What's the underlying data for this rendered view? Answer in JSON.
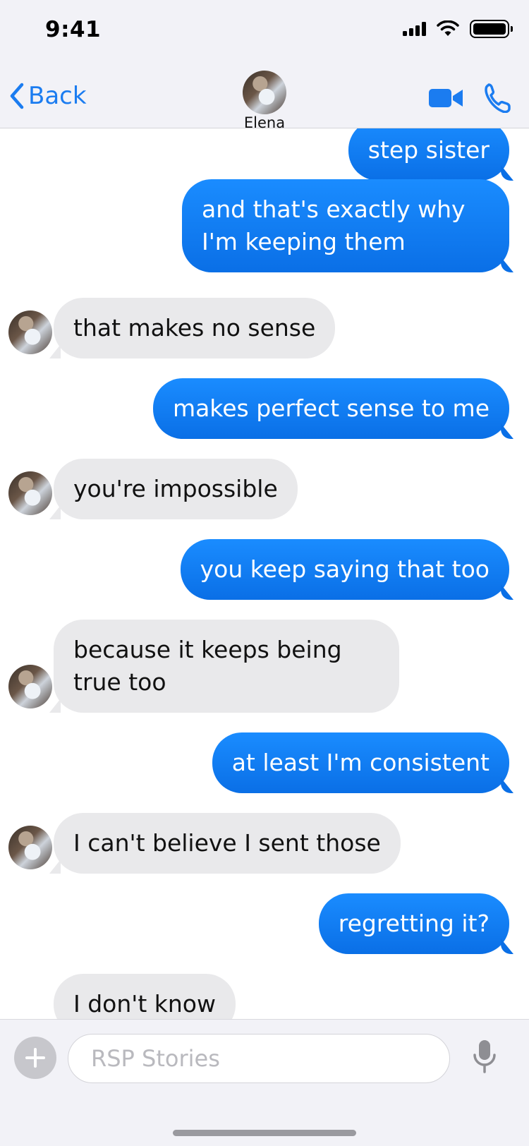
{
  "status_bar": {
    "time": "9:41"
  },
  "header": {
    "back_label": "Back",
    "contact_name": "Elena",
    "icons": {
      "back": "chevron-left-icon",
      "video": "video-camera-icon",
      "call": "phone-icon"
    },
    "accent": "#1b7cf0"
  },
  "messages": [
    {
      "from": "me",
      "text": "step sister"
    },
    {
      "from": "me",
      "text": "and that's exactly why I'm keeping them"
    },
    {
      "from": "them",
      "text": "that makes no sense"
    },
    {
      "from": "me",
      "text": "makes perfect sense to me"
    },
    {
      "from": "them",
      "text": "you're impossible"
    },
    {
      "from": "me",
      "text": "you keep saying that too"
    },
    {
      "from": "them",
      "text": "because it keeps being true too"
    },
    {
      "from": "me",
      "text": "at least I'm consistent"
    },
    {
      "from": "them",
      "text": "I can't believe I sent those"
    },
    {
      "from": "me",
      "text": "regretting it?"
    },
    {
      "from": "them",
      "text": "I don't know"
    }
  ],
  "composer": {
    "placeholder": "RSP Stories",
    "icons": {
      "add": "plus-icon",
      "mic": "microphone-icon"
    }
  },
  "colors": {
    "outgoing_bubble": "#0a7cf5",
    "incoming_bubble": "#e9e9eb",
    "bar_background": "#f2f2f7"
  }
}
